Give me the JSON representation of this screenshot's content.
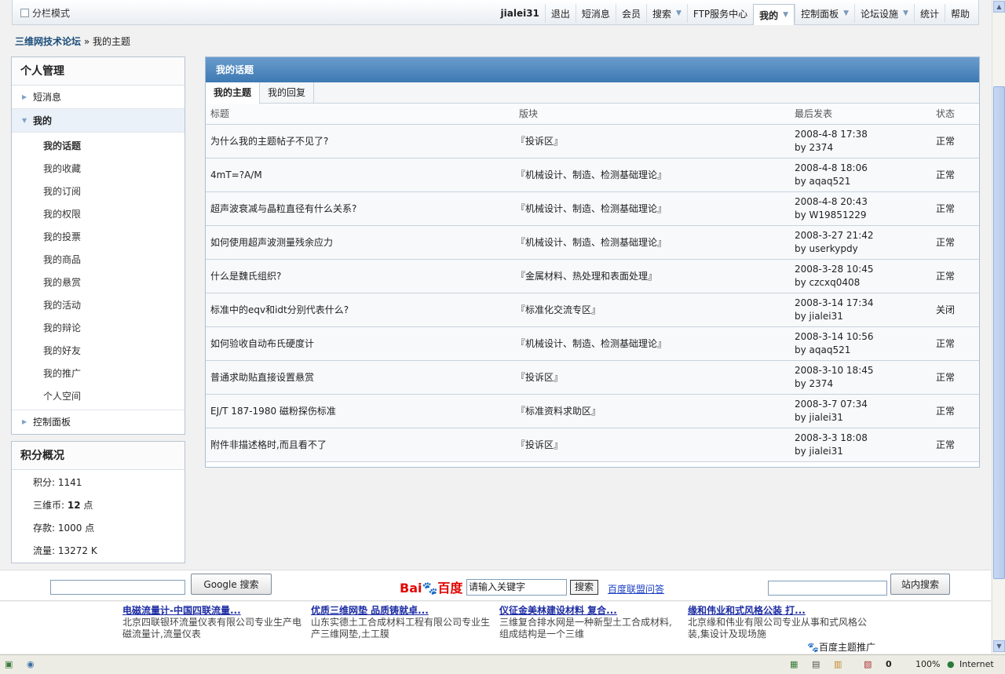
{
  "topbar": {
    "split_label": "分栏模式",
    "user": "jialei31",
    "nav": [
      {
        "label": "退出",
        "dropdown": false
      },
      {
        "label": "短消息",
        "dropdown": false
      },
      {
        "label": "会员",
        "dropdown": false
      },
      {
        "label": "搜索",
        "dropdown": true
      },
      {
        "label": "FTP服务中心",
        "dropdown": false
      },
      {
        "label": "我的",
        "dropdown": true,
        "active": true
      },
      {
        "label": "控制面板",
        "dropdown": true
      },
      {
        "label": "论坛设施",
        "dropdown": true
      },
      {
        "label": "统计",
        "dropdown": false
      },
      {
        "label": "帮助",
        "dropdown": false
      }
    ]
  },
  "breadcrumb": {
    "home": "三维网技术论坛",
    "sep": "»",
    "current": "我的主题"
  },
  "sidebar": {
    "title": "个人管理",
    "messages": "短消息",
    "mine": "我的",
    "sub": [
      "我的话题",
      "我的收藏",
      "我的订阅",
      "我的权限",
      "我的投票",
      "我的商品",
      "我的悬赏",
      "我的活动",
      "我的辩论",
      "我的好友",
      "我的推广",
      "个人空间"
    ],
    "control_panel": "控制面板"
  },
  "score": {
    "title": "积分概况",
    "points_label": "积分:",
    "points": "1141",
    "coin_label": "三维币:",
    "coin": "12",
    "coin_unit": "点",
    "deposit_label": "存款:",
    "deposit": "1000 点",
    "traffic_label": "流量:",
    "traffic": "13272 K"
  },
  "main": {
    "title": "我的话题",
    "tabs": [
      "我的主题",
      "我的回复"
    ],
    "columns": [
      "标题",
      "版块",
      "最后发表",
      "状态"
    ],
    "rows": [
      {
        "title": "为什么我的主题帖子不见了?",
        "forum": "『投诉区』",
        "date": "2008-4-8 17:38",
        "by": "by 2374",
        "status": "正常"
      },
      {
        "title": "4mT=?A/M",
        "forum": "『机械设计、制造、检测基础理论』",
        "date": "2008-4-8 18:06",
        "by": "by aqaq521",
        "status": "正常"
      },
      {
        "title": "超声波衰减与晶粒直径有什么关系?",
        "forum": "『机械设计、制造、检测基础理论』",
        "date": "2008-4-8 20:43",
        "by": "by W19851229",
        "status": "正常"
      },
      {
        "title": "如何使用超声波测量残余应力",
        "forum": "『机械设计、制造、检测基础理论』",
        "date": "2008-3-27 21:42",
        "by": "by userkypdy",
        "status": "正常"
      },
      {
        "title": "什么是魏氏组织?",
        "forum": "『金属材料、热处理和表面处理』",
        "date": "2008-3-28 10:45",
        "by": "by czcxq0408",
        "status": "正常"
      },
      {
        "title": "标准中的eqv和idt分别代表什么?",
        "forum": "『标准化交流专区』",
        "date": "2008-3-14 17:34",
        "by": "by jialei31",
        "status": "关闭"
      },
      {
        "title": "如何验收自动布氏硬度计",
        "forum": "『机械设计、制造、检测基础理论』",
        "date": "2008-3-14 10:56",
        "by": "by aqaq521",
        "status": "正常"
      },
      {
        "title": "普通求助贴直接设置悬赏",
        "forum": "『投诉区』",
        "date": "2008-3-10 18:45",
        "by": "by 2374",
        "status": "正常"
      },
      {
        "title": "EJ/T 187-1980 磁粉探伤标准",
        "forum": "『标准资料求助区』",
        "date": "2008-3-7 07:34",
        "by": "by jialei31",
        "status": "正常"
      },
      {
        "title": "附件非描述格时,而且看不了",
        "forum": "『投诉区』",
        "date": "2008-3-3 18:08",
        "by": "by jialei31",
        "status": "正常"
      }
    ]
  },
  "search": {
    "google_button": "Google 搜索",
    "baidu_logo_a": "Bai",
    "baidu_logo_b": "百度",
    "baidu_input": "请输入关键字",
    "baidu_button": "搜索",
    "baidu_link": "百度联盟问答",
    "site_button": "站内搜索"
  },
  "ads": [
    {
      "title": "电磁流量计-中国四联流量...",
      "desc": "北京四联银环流量仪表有限公司专业生产电磁流量计,流量仪表"
    },
    {
      "title": "优质三维网垫 品质铸就卓...",
      "desc": "山东实德土工合成材料工程有限公司专业生产三维网垫,土工膜"
    },
    {
      "title": "仪征金美林建设材料 复合...",
      "desc": "三维复合排水网是一种新型土工合成材料,组成结构是一个三维"
    },
    {
      "title": "缘和伟业和式风格公装 打...",
      "desc": "北京缘和伟业有限公司专业从事和式风格公装,集设计及现场施"
    }
  ],
  "ads_promo": "百度主题推广",
  "statusbar": {
    "count": "0",
    "zoom": "100%",
    "zone": "Internet"
  },
  "colors": {
    "header_blue": "#3d79b3",
    "link_blue": "#1a4d7a",
    "ad_title": "#1c2ca3",
    "baidu_red": "#e10602"
  }
}
